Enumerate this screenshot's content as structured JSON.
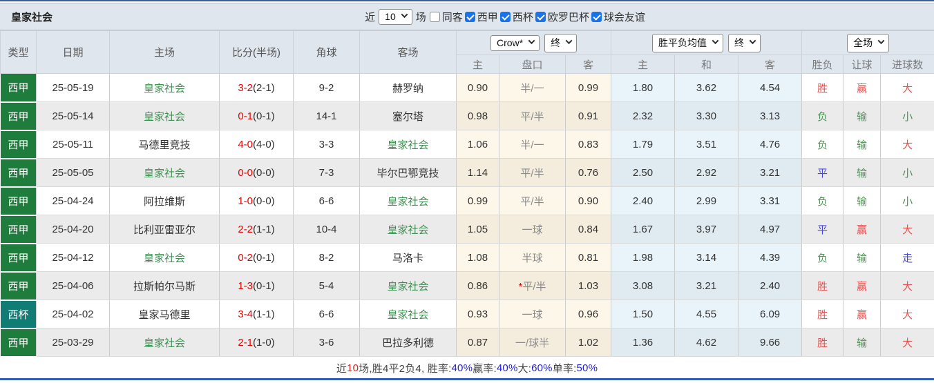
{
  "header": {
    "title": "皇家社会",
    "recent_label_before": "近",
    "recent_value": "10",
    "recent_label_after": "场",
    "checkboxes": [
      {
        "label": "同客",
        "checked": false
      },
      {
        "label": "西甲",
        "checked": true
      },
      {
        "label": "西杯",
        "checked": true
      },
      {
        "label": "欧罗巴杯",
        "checked": true
      },
      {
        "label": "球会友谊",
        "checked": true
      }
    ]
  },
  "table": {
    "main_headers": [
      "类型",
      "日期",
      "主场",
      "比分(半场)",
      "角球",
      "客场"
    ],
    "dropdowns": {
      "odds_company": "Crow*",
      "odds_time1": "终",
      "avg_label": "胜平负均值",
      "odds_time2": "终",
      "scope": "全场"
    },
    "sub_headers": [
      "主",
      "盘口",
      "客",
      "主",
      "和",
      "客",
      "胜负",
      "让球",
      "进球数"
    ],
    "league_colors": {
      "西甲": "#1e7c3c",
      "西杯": "#117c74"
    },
    "rows": [
      {
        "league": "西甲",
        "date": "25-05-19",
        "home": "皇家社会",
        "home_is_self": true,
        "score_full": "3-2",
        "score_half": "(2-1)",
        "corners": "9-2",
        "away": "赫罗纳",
        "away_is_self": false,
        "odds_home": "0.90",
        "handicap": "半/一",
        "handicap_star": false,
        "odds_away": "0.99",
        "avg_home": "1.80",
        "avg_draw": "3.62",
        "avg_away": "4.54",
        "result_wdl": {
          "text": "胜",
          "color": "red"
        },
        "result_handicap": {
          "text": "赢",
          "color": "red"
        },
        "result_goals": {
          "text": "大",
          "color": "red"
        }
      },
      {
        "league": "西甲",
        "date": "25-05-14",
        "home": "皇家社会",
        "home_is_self": true,
        "score_full": "0-1",
        "score_half": "(0-1)",
        "corners": "14-1",
        "away": "塞尔塔",
        "away_is_self": false,
        "odds_home": "0.98",
        "handicap": "平/半",
        "handicap_star": false,
        "odds_away": "0.91",
        "avg_home": "2.32",
        "avg_draw": "3.30",
        "avg_away": "3.13",
        "result_wdl": {
          "text": "负",
          "color": "green"
        },
        "result_handicap": {
          "text": "输",
          "color": "green"
        },
        "result_goals": {
          "text": "小",
          "color": "green"
        }
      },
      {
        "league": "西甲",
        "date": "25-05-11",
        "home": "马德里竞技",
        "home_is_self": false,
        "score_full": "4-0",
        "score_half": "(4-0)",
        "corners": "3-3",
        "away": "皇家社会",
        "away_is_self": true,
        "odds_home": "1.06",
        "handicap": "半/一",
        "handicap_star": false,
        "odds_away": "0.83",
        "avg_home": "1.79",
        "avg_draw": "3.51",
        "avg_away": "4.76",
        "result_wdl": {
          "text": "负",
          "color": "green"
        },
        "result_handicap": {
          "text": "输",
          "color": "green"
        },
        "result_goals": {
          "text": "大",
          "color": "red"
        }
      },
      {
        "league": "西甲",
        "date": "25-05-05",
        "home": "皇家社会",
        "home_is_self": true,
        "score_full": "0-0",
        "score_half": "(0-0)",
        "corners": "7-3",
        "away": "毕尔巴鄂竞技",
        "away_is_self": false,
        "odds_home": "1.14",
        "handicap": "平/半",
        "handicap_star": false,
        "odds_away": "0.76",
        "avg_home": "2.50",
        "avg_draw": "2.92",
        "avg_away": "3.21",
        "result_wdl": {
          "text": "平",
          "color": "blue"
        },
        "result_handicap": {
          "text": "输",
          "color": "green"
        },
        "result_goals": {
          "text": "小",
          "color": "green"
        }
      },
      {
        "league": "西甲",
        "date": "25-04-24",
        "home": "阿拉维斯",
        "home_is_self": false,
        "score_full": "1-0",
        "score_half": "(0-0)",
        "corners": "6-6",
        "away": "皇家社会",
        "away_is_self": true,
        "odds_home": "0.99",
        "handicap": "平/半",
        "handicap_star": false,
        "odds_away": "0.90",
        "avg_home": "2.40",
        "avg_draw": "2.99",
        "avg_away": "3.31",
        "result_wdl": {
          "text": "负",
          "color": "green"
        },
        "result_handicap": {
          "text": "输",
          "color": "green"
        },
        "result_goals": {
          "text": "小",
          "color": "green"
        }
      },
      {
        "league": "西甲",
        "date": "25-04-20",
        "home": "比利亚雷亚尔",
        "home_is_self": false,
        "score_full": "2-2",
        "score_half": "(1-1)",
        "corners": "10-4",
        "away": "皇家社会",
        "away_is_self": true,
        "odds_home": "1.05",
        "handicap": "一球",
        "handicap_star": false,
        "odds_away": "0.84",
        "avg_home": "1.67",
        "avg_draw": "3.97",
        "avg_away": "4.97",
        "result_wdl": {
          "text": "平",
          "color": "blue"
        },
        "result_handicap": {
          "text": "赢",
          "color": "red"
        },
        "result_goals": {
          "text": "大",
          "color": "red"
        }
      },
      {
        "league": "西甲",
        "date": "25-04-12",
        "home": "皇家社会",
        "home_is_self": true,
        "score_full": "0-2",
        "score_half": "(0-1)",
        "corners": "8-2",
        "away": "马洛卡",
        "away_is_self": false,
        "odds_home": "1.08",
        "handicap": "半球",
        "handicap_star": false,
        "odds_away": "0.81",
        "avg_home": "1.98",
        "avg_draw": "3.14",
        "avg_away": "4.39",
        "result_wdl": {
          "text": "负",
          "color": "green"
        },
        "result_handicap": {
          "text": "输",
          "color": "green"
        },
        "result_goals": {
          "text": "走",
          "color": "blue"
        }
      },
      {
        "league": "西甲",
        "date": "25-04-06",
        "home": "拉斯帕尔马斯",
        "home_is_self": false,
        "score_full": "1-3",
        "score_half": "(0-1)",
        "corners": "5-4",
        "away": "皇家社会",
        "away_is_self": true,
        "odds_home": "0.86",
        "handicap": "平/半",
        "handicap_star": true,
        "odds_away": "1.03",
        "avg_home": "3.08",
        "avg_draw": "3.21",
        "avg_away": "2.40",
        "result_wdl": {
          "text": "胜",
          "color": "red"
        },
        "result_handicap": {
          "text": "赢",
          "color": "red"
        },
        "result_goals": {
          "text": "大",
          "color": "red"
        }
      },
      {
        "league": "西杯",
        "date": "25-04-02",
        "home": "皇家马德里",
        "home_is_self": false,
        "score_full": "3-4",
        "score_half": "(1-1)",
        "corners": "6-6",
        "away": "皇家社会",
        "away_is_self": true,
        "odds_home": "0.93",
        "handicap": "一球",
        "handicap_star": false,
        "odds_away": "0.96",
        "avg_home": "1.50",
        "avg_draw": "4.55",
        "avg_away": "6.09",
        "result_wdl": {
          "text": "胜",
          "color": "red"
        },
        "result_handicap": {
          "text": "赢",
          "color": "red"
        },
        "result_goals": {
          "text": "大",
          "color": "red"
        }
      },
      {
        "league": "西甲",
        "date": "25-03-29",
        "home": "皇家社会",
        "home_is_self": true,
        "score_full": "2-1",
        "score_half": "(1-0)",
        "corners": "3-6",
        "away": "巴拉多利德",
        "away_is_self": false,
        "odds_home": "0.87",
        "handicap": "一/球半",
        "handicap_star": false,
        "odds_away": "1.02",
        "avg_home": "1.36",
        "avg_draw": "4.62",
        "avg_away": "9.66",
        "result_wdl": {
          "text": "胜",
          "color": "red"
        },
        "result_handicap": {
          "text": "输",
          "color": "green"
        },
        "result_goals": {
          "text": "大",
          "color": "red"
        }
      }
    ]
  },
  "summary": {
    "segments": [
      {
        "text": "近",
        "color": "default"
      },
      {
        "text": "10",
        "color": "red"
      },
      {
        "text": "场,胜4平2负4, 胜率:",
        "color": "default"
      },
      {
        "text": "40%",
        "color": "blue"
      },
      {
        "text": " 赢率:",
        "color": "default"
      },
      {
        "text": "40%",
        "color": "blue"
      },
      {
        "text": " 大:",
        "color": "default"
      },
      {
        "text": "60%",
        "color": "blue"
      },
      {
        "text": " 单率:",
        "color": "default"
      },
      {
        "text": "50%",
        "color": "blue"
      }
    ]
  },
  "colors": {
    "result_red": "#e95050",
    "result_green": "#4f9356",
    "result_blue": "#4545e2",
    "score_red": "#e60000",
    "self_team_green": "#3f9053",
    "league_liga_green": "#1e7c3c",
    "league_cup_teal": "#117c74",
    "header_bg": "#dfe6ee"
  }
}
